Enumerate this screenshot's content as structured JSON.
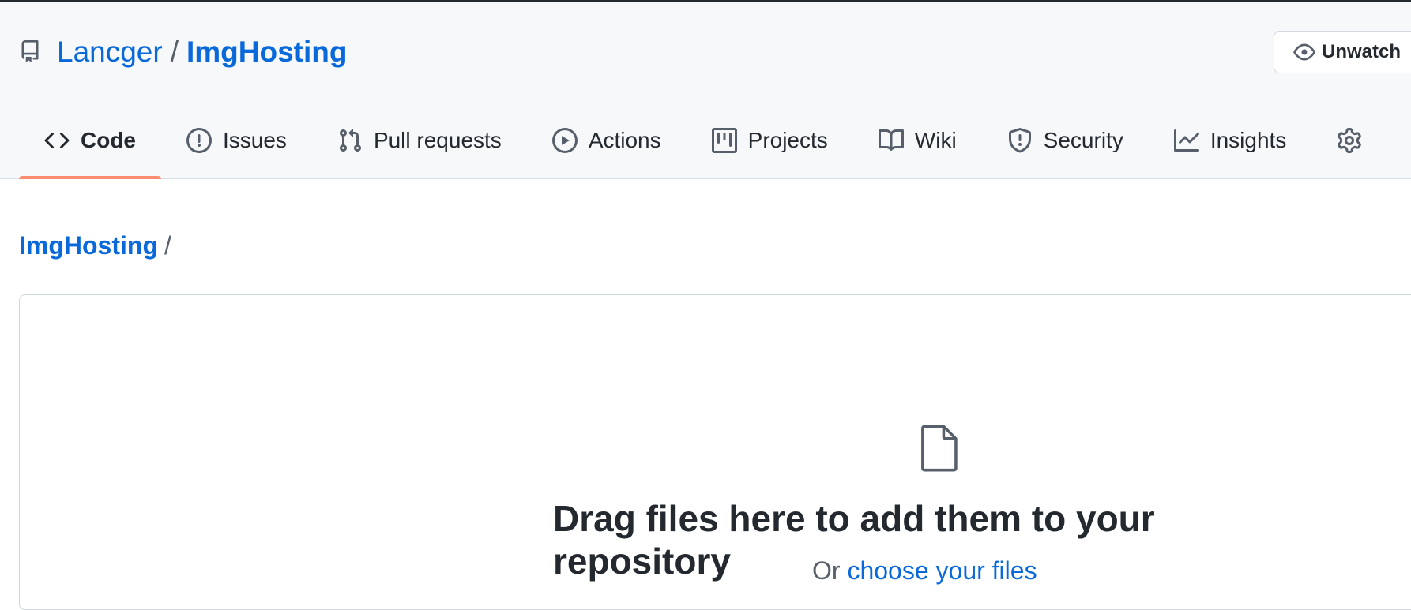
{
  "repo": {
    "owner": "Lancger",
    "separator": "/",
    "name": "ImgHosting"
  },
  "watch_button": {
    "label": "Unwatch"
  },
  "tabs": [
    {
      "label": "Code",
      "icon": "code-icon",
      "active": true
    },
    {
      "label": "Issues",
      "icon": "issue-opened-icon"
    },
    {
      "label": "Pull requests",
      "icon": "git-pull-request-icon"
    },
    {
      "label": "Actions",
      "icon": "play-icon"
    },
    {
      "label": "Projects",
      "icon": "project-icon"
    },
    {
      "label": "Wiki",
      "icon": "book-icon"
    },
    {
      "label": "Security",
      "icon": "shield-icon"
    },
    {
      "label": "Insights",
      "icon": "graph-icon"
    }
  ],
  "breadcrumb": {
    "root": "ImgHosting",
    "separator": "/"
  },
  "dropzone": {
    "heading": "Drag files here to add them to your repository",
    "or_text": "Or ",
    "choose_link": "choose your files"
  },
  "colors": {
    "link": "#0969da",
    "active_tab_underline": "#fd8c73",
    "header_bg": "#f6f8fa"
  }
}
